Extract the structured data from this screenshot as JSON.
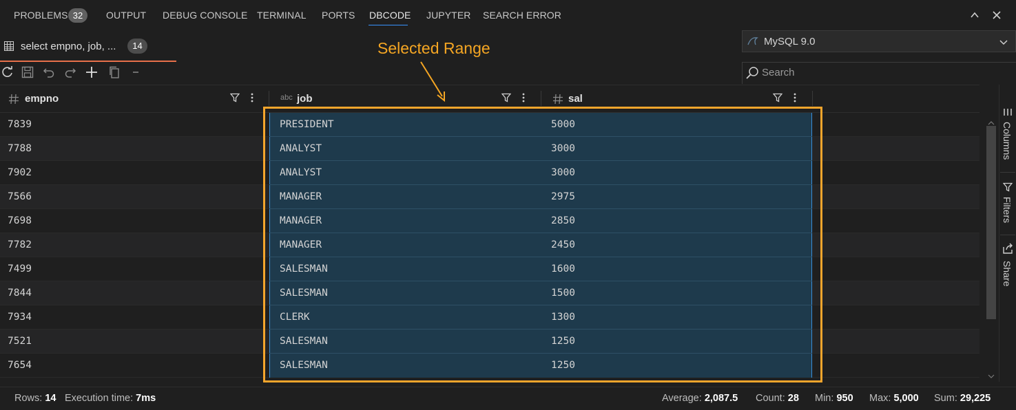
{
  "panel_tabs": [
    {
      "label": "PROBLEMS",
      "badge": "32"
    },
    {
      "label": "OUTPUT"
    },
    {
      "label": "DEBUG CONSOLE"
    },
    {
      "label": "TERMINAL"
    },
    {
      "label": "PORTS"
    },
    {
      "label": "DBCODE",
      "active": true
    },
    {
      "label": "JUPYTER"
    },
    {
      "label": "SEARCH ERROR"
    }
  ],
  "query_tab": {
    "label": "select empno, job, ...",
    "badge": "14"
  },
  "connection": {
    "label": "MySQL 9.0"
  },
  "search": {
    "placeholder": "Search"
  },
  "annotation": {
    "label": "Selected Range",
    "color": "#f5a623"
  },
  "columns": [
    {
      "name": "empno",
      "type_icon": "hash-icon"
    },
    {
      "name": "job",
      "type_icon": "abc-icon",
      "type_label": "abc"
    },
    {
      "name": "sal",
      "type_icon": "hash-icon"
    }
  ],
  "rows": [
    [
      "7839",
      "PRESIDENT",
      "5000"
    ],
    [
      "7788",
      "ANALYST",
      "3000"
    ],
    [
      "7902",
      "ANALYST",
      "3000"
    ],
    [
      "7566",
      "MANAGER",
      "2975"
    ],
    [
      "7698",
      "MANAGER",
      "2850"
    ],
    [
      "7782",
      "MANAGER",
      "2450"
    ],
    [
      "7499",
      "SALESMAN",
      "1600"
    ],
    [
      "7844",
      "SALESMAN",
      "1500"
    ],
    [
      "7934",
      "CLERK",
      "1300"
    ],
    [
      "7521",
      "SALESMAN",
      "1250"
    ],
    [
      "7654",
      "SALESMAN",
      "1250"
    ]
  ],
  "side_panel": [
    "Columns",
    "Filters",
    "Share"
  ],
  "status": {
    "rows_label": "Rows:",
    "rows_value": "14",
    "exec_label": "Execution time:",
    "exec_value": "7ms",
    "avg_label": "Average:",
    "avg_value": "2,087.5",
    "count_label": "Count:",
    "count_value": "28",
    "min_label": "Min:",
    "min_value": "950",
    "max_label": "Max:",
    "max_value": "5,000",
    "sum_label": "Sum:",
    "sum_value": "29,225"
  }
}
